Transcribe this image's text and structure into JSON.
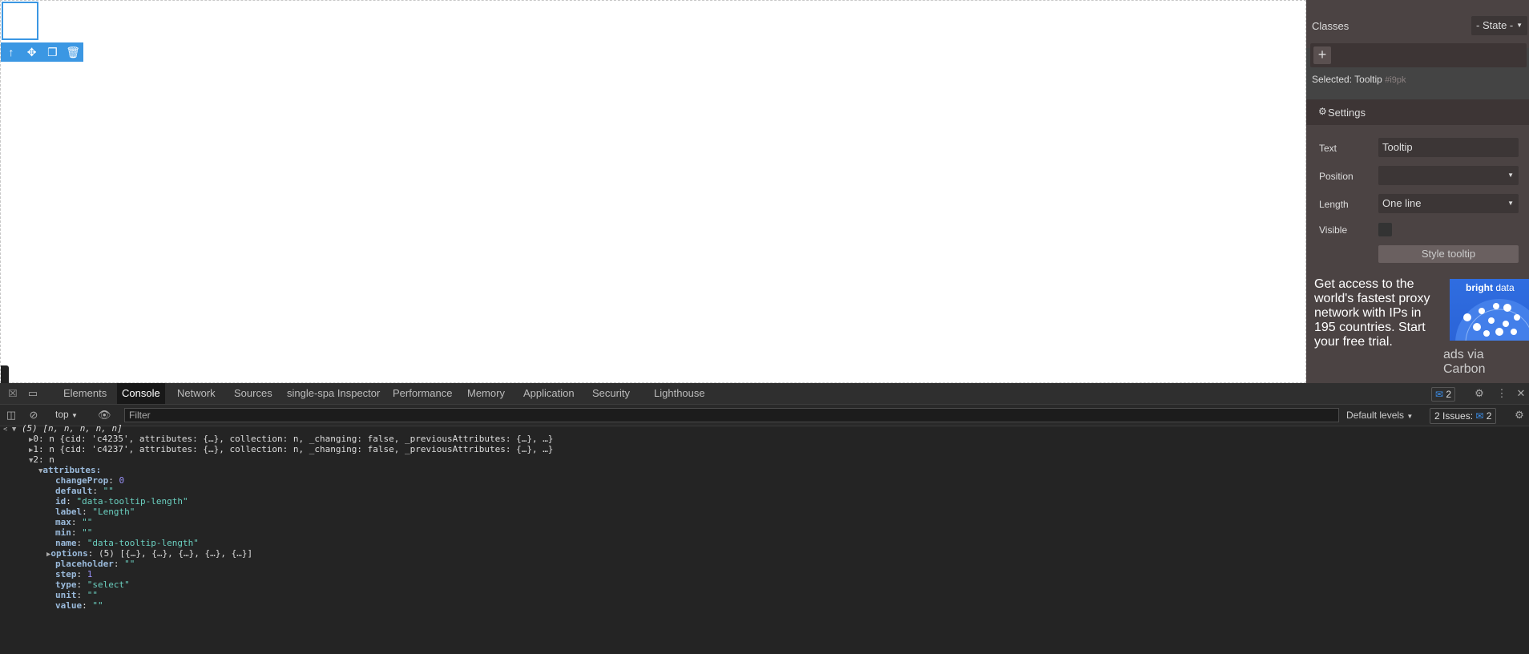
{
  "panel": {
    "classes_label": "Classes",
    "state_select": "- State -",
    "add_class": "+",
    "selected_label": "Selected:",
    "selected_name": "Tooltip",
    "selected_id": "#i9pk",
    "settings_title": "Settings",
    "traits": [
      {
        "label": "Text",
        "value": "Tooltip"
      },
      {
        "label": "Position",
        "value": ""
      },
      {
        "label": "Length",
        "value": "One line"
      },
      {
        "label": "Visible",
        "value": ""
      }
    ],
    "style_button": "Style tooltip",
    "ad_text": "Get access to the world's fastest proxy network with IPs in 195 countries. Start your free trial.",
    "ad_brand": "bright",
    "ad_brand2": " data",
    "ad_via": "ads via Carbon"
  },
  "devtools": {
    "tabs": [
      "Elements",
      "Console",
      "Network",
      "Sources",
      "single-spa Inspector",
      "Performance",
      "Memory",
      "Application",
      "Security",
      "Lighthouse"
    ],
    "active_tab": "Console",
    "messages_count": "2",
    "context": "top",
    "filter_placeholder": "Filter",
    "levels": "Default levels",
    "issues": "2 Issues:",
    "issues_count": "2"
  },
  "console": {
    "header": "(5) [n, n, n, n, n]",
    "item0": "0: n {cid: 'c4235', attributes: {…}, collection: n, _changing: false, _previousAttributes: {…}, …}",
    "item1": "1: n {cid: 'c4237', attributes: {…}, collection: n, _changing: false, _previousAttributes: {…}, …}",
    "item2": "2: n",
    "attributes": "attributes:",
    "props": [
      {
        "key": "changeProp",
        "value": "0",
        "kind": "num"
      },
      {
        "key": "default",
        "value": "\"\"",
        "kind": "str"
      },
      {
        "key": "id",
        "value": "\"data-tooltip-length\"",
        "kind": "str"
      },
      {
        "key": "label",
        "value": "\"Length\"",
        "kind": "str"
      },
      {
        "key": "max",
        "value": "\"\"",
        "kind": "str"
      },
      {
        "key": "min",
        "value": "\"\"",
        "kind": "str"
      },
      {
        "key": "name",
        "value": "\"data-tooltip-length\"",
        "kind": "str"
      },
      {
        "key": "options",
        "value": "(5) [{…}, {…}, {…}, {…}, {…}]",
        "kind": "plain"
      },
      {
        "key": "placeholder",
        "value": "\"\"",
        "kind": "str"
      },
      {
        "key": "step",
        "value": "1",
        "kind": "num"
      },
      {
        "key": "type",
        "value": "\"select\"",
        "kind": "str"
      },
      {
        "key": "unit",
        "value": "\"\"",
        "kind": "str"
      },
      {
        "key": "value",
        "value": "\"\"",
        "kind": "str"
      }
    ]
  }
}
